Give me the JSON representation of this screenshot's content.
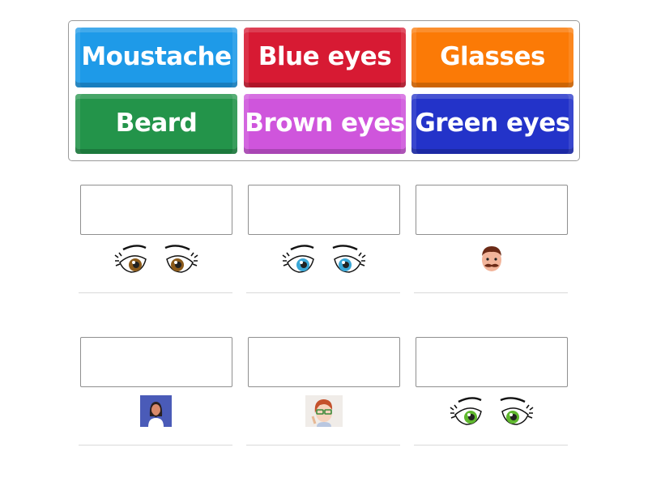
{
  "word_bank": {
    "tiles": [
      {
        "label": "Moustache",
        "color": "#1e9ae8"
      },
      {
        "label": "Blue eyes",
        "color": "#d71a33"
      },
      {
        "label": "Glasses",
        "color": "#fb7a06"
      },
      {
        "label": "Beard",
        "color": "#23944a"
      },
      {
        "label": "Brown eyes",
        "color": "#cf55dc"
      },
      {
        "label": "Green eyes",
        "color": "#2333c9"
      }
    ]
  },
  "targets": [
    {
      "answer": "",
      "image": "brown-eyes-image"
    },
    {
      "answer": "",
      "image": "blue-eyes-image"
    },
    {
      "answer": "",
      "image": "moustache-man-image"
    },
    {
      "answer": "",
      "image": "bearded-man-image"
    },
    {
      "answer": "",
      "image": "girl-with-glasses-image"
    },
    {
      "answer": "",
      "image": "green-eyes-image"
    }
  ],
  "eye_colors": {
    "brown": "#8b5a1a",
    "blue": "#3aa7d6",
    "green": "#5fb82e"
  }
}
